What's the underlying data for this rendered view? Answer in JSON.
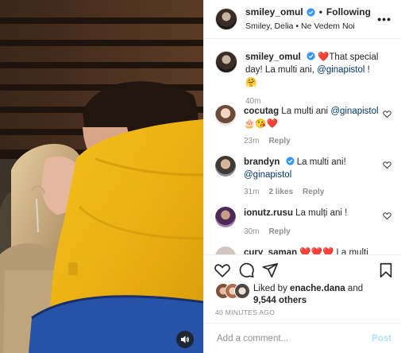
{
  "header": {
    "username": "smiley_omul",
    "separator": "•",
    "follow_label": "Following",
    "subtitle": "Smiley, Delia • Ne Vedem Noi",
    "more_label": "•••"
  },
  "caption": {
    "username": "smiley_omul",
    "text_before": "That special day! La multi ani,",
    "mention": "@ginapistol",
    "text_after": "! 🤗",
    "time": "40m"
  },
  "comments": [
    {
      "username": "cocutag",
      "text": "La multi ani",
      "mention": "@ginapistol",
      "emoji": "🎂😘❤️",
      "time": "23m",
      "reply": "Reply",
      "likes": ""
    },
    {
      "username": "brandyn",
      "text": "La multi ani!",
      "mention": "@ginapistol",
      "emoji": "",
      "time": "31m",
      "likes": "2 likes",
      "reply": "Reply"
    },
    {
      "username": "ionutz.rusu",
      "text": "La mulți ani !",
      "mention": "",
      "emoji": "",
      "time": "30m",
      "reply": "Reply",
      "likes": ""
    },
    {
      "username": "cury_saman",
      "text": "❤️❤️❤️ La multi ani",
      "mention": "",
      "emoji": "",
      "time": "",
      "reply": "",
      "likes": ""
    }
  ],
  "likes": {
    "prefix": "Liked by",
    "user": "enache.dana",
    "and": "and",
    "others": "9,544 others"
  },
  "timestamp": "40 MINUTES AGO",
  "add_comment": {
    "placeholder": "Add a comment...",
    "post_label": "Post"
  },
  "icons": {
    "verified": "verified-badge-icon",
    "heart": "heart-icon",
    "comment": "comment-icon",
    "share": "share-icon",
    "save": "bookmark-icon",
    "mute": "speaker-icon"
  },
  "colors": {
    "verified_blue": "#3897f0",
    "link_blue": "#00376b",
    "muted_gray": "#8e8e8e",
    "post_blue_disabled": "#b2dffc"
  }
}
